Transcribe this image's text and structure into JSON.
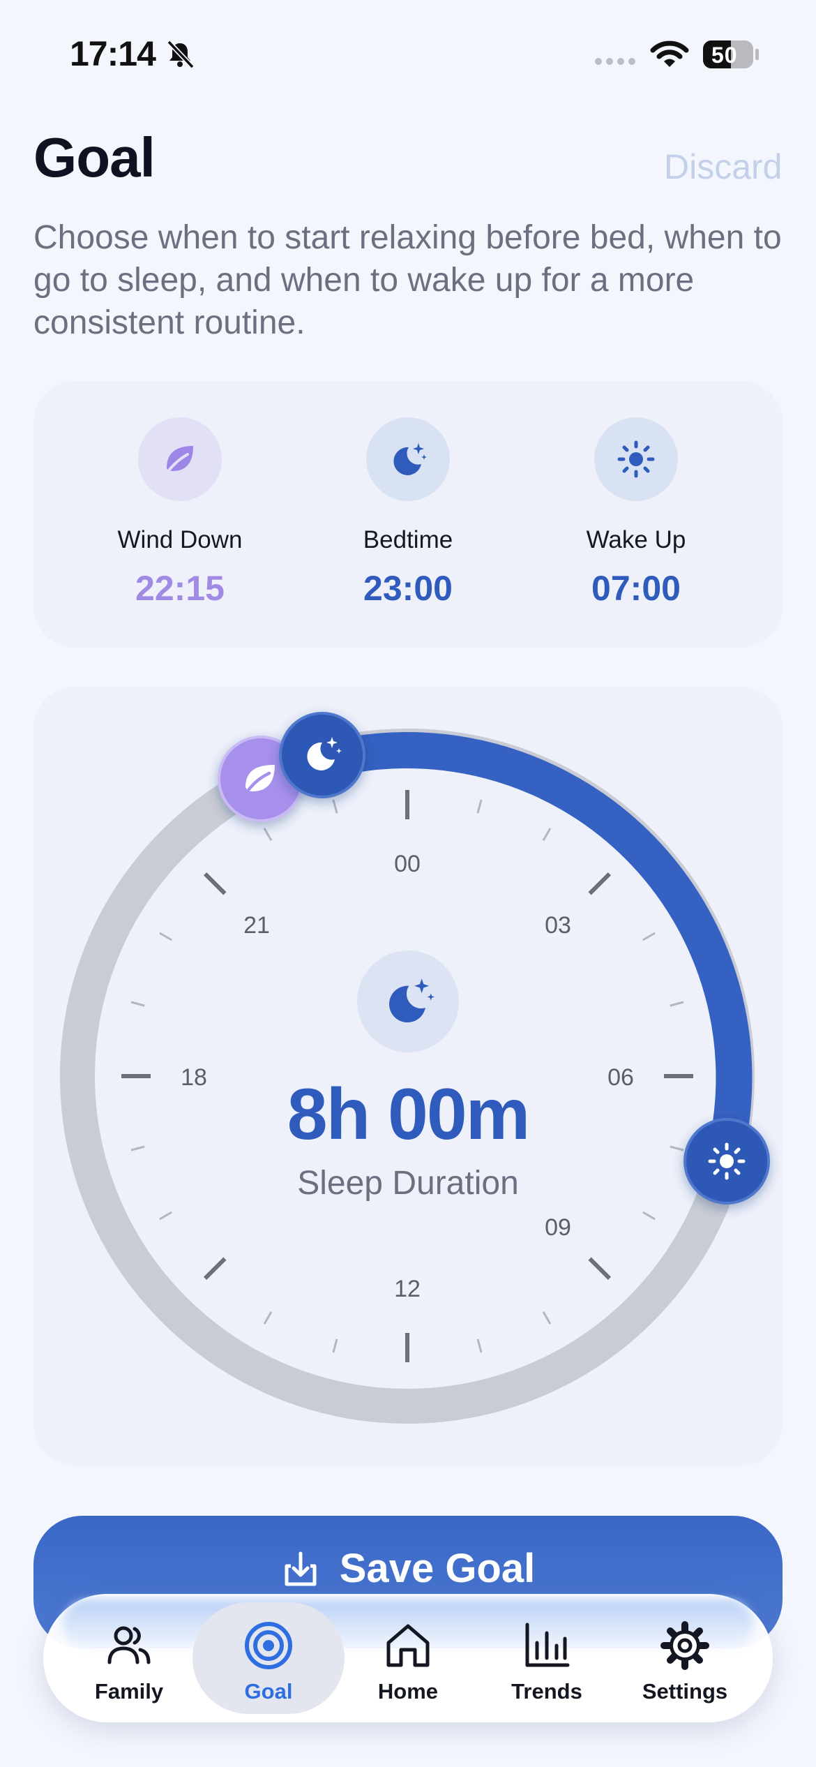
{
  "status_bar": {
    "time": "17:14",
    "battery": "50"
  },
  "header": {
    "title": "Goal",
    "discard_label": "Discard",
    "subtitle": "Choose when to start relaxing before bed, when to go to sleep, and when to wake up for a more consistent routine."
  },
  "summary": {
    "wind_down": {
      "label": "Wind Down",
      "time": "22:15",
      "icon": "leaf-icon"
    },
    "bedtime": {
      "label": "Bedtime",
      "time": "23:00",
      "icon": "moon-stars-icon"
    },
    "wake_up": {
      "label": "Wake Up",
      "time": "07:00",
      "icon": "sun-icon"
    }
  },
  "dial": {
    "hour_labels": {
      "00": "00",
      "03": "03",
      "06": "06",
      "09": "09",
      "12": "12",
      "18": "18",
      "21": "21"
    },
    "duration": "8h 00m",
    "duration_label": "Sleep Duration",
    "colors": {
      "track": "#c9ccd4",
      "arc": "#3561c2",
      "wind_down": "#a38bea",
      "accent": "#2f5bbd"
    }
  },
  "save_button": {
    "label": "Save Goal"
  },
  "tabs": [
    {
      "label": "Family",
      "icon": "people-icon"
    },
    {
      "label": "Goal",
      "icon": "target-icon",
      "active": true
    },
    {
      "label": "Home",
      "icon": "home-icon"
    },
    {
      "label": "Trends",
      "icon": "bar-chart-icon"
    },
    {
      "label": "Settings",
      "icon": "gear-icon"
    }
  ]
}
